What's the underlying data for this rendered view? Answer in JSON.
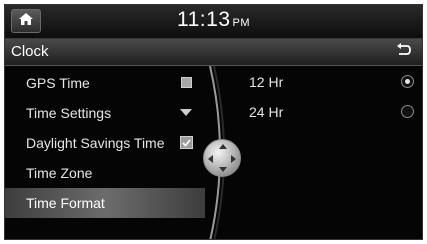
{
  "status": {
    "time": "11:13",
    "ampm": "PM",
    "home_icon": "home-icon"
  },
  "titlebar": {
    "title": "Clock",
    "back_icon": "back-arrow-icon"
  },
  "menu": {
    "items": [
      {
        "label": "GPS Time",
        "control": "checkbox",
        "checked": false
      },
      {
        "label": "Time Settings",
        "control": "dropdown"
      },
      {
        "label": "Daylight Savings Time",
        "control": "checkbox",
        "checked": true
      },
      {
        "label": "Time Zone",
        "control": "none"
      },
      {
        "label": "Time Format",
        "control": "none",
        "selected": true
      }
    ]
  },
  "options": [
    {
      "label": "12 Hr",
      "selected": true
    },
    {
      "label": "24 Hr",
      "selected": false
    }
  ],
  "colors": {
    "background": "#050505",
    "text": "#e6e6e6",
    "selected_row": "#6c6c6c"
  }
}
